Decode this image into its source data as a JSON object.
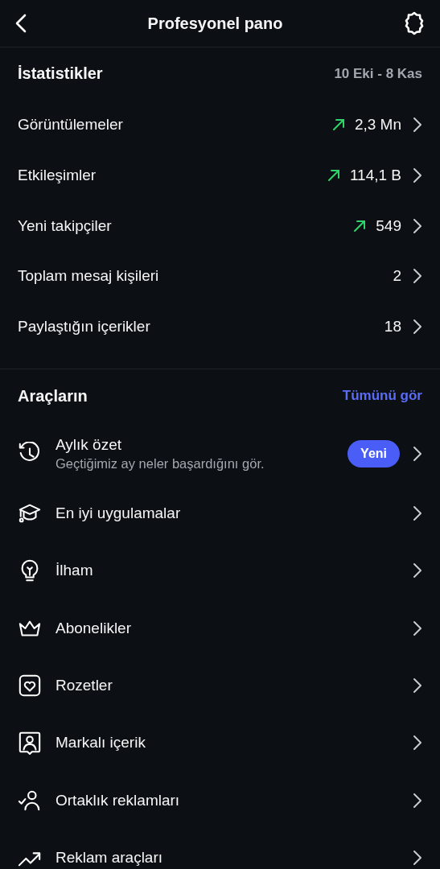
{
  "header": {
    "title": "Profesyonel pano"
  },
  "statistics": {
    "title": "İstatistikler",
    "date_range": "10 Eki - 8 Kas",
    "rows": [
      {
        "label": "Görüntülemeler",
        "value": "2,3 Mn",
        "trending_up": true
      },
      {
        "label": "Etkileşimler",
        "value": "114,1 B",
        "trending_up": true
      },
      {
        "label": "Yeni takipçiler",
        "value": "549",
        "trending_up": true
      },
      {
        "label": "Toplam mesaj kişileri",
        "value": "2",
        "trending_up": false
      },
      {
        "label": "Paylaştığın içerikler",
        "value": "18",
        "trending_up": false
      }
    ]
  },
  "tools": {
    "title": "Araçların",
    "see_all": "Tümünü gör",
    "items": [
      {
        "label": "Aylık özet",
        "subtitle": "Geçtiğimiz ay neler başardığını gör.",
        "badge": "Yeni"
      },
      {
        "label": "En iyi uygulamalar"
      },
      {
        "label": "İlham"
      },
      {
        "label": "Abonelikler"
      },
      {
        "label": "Rozetler"
      },
      {
        "label": "Markalı içerik"
      },
      {
        "label": "Ortaklık reklamları"
      },
      {
        "label": "Reklam araçları"
      }
    ]
  }
}
